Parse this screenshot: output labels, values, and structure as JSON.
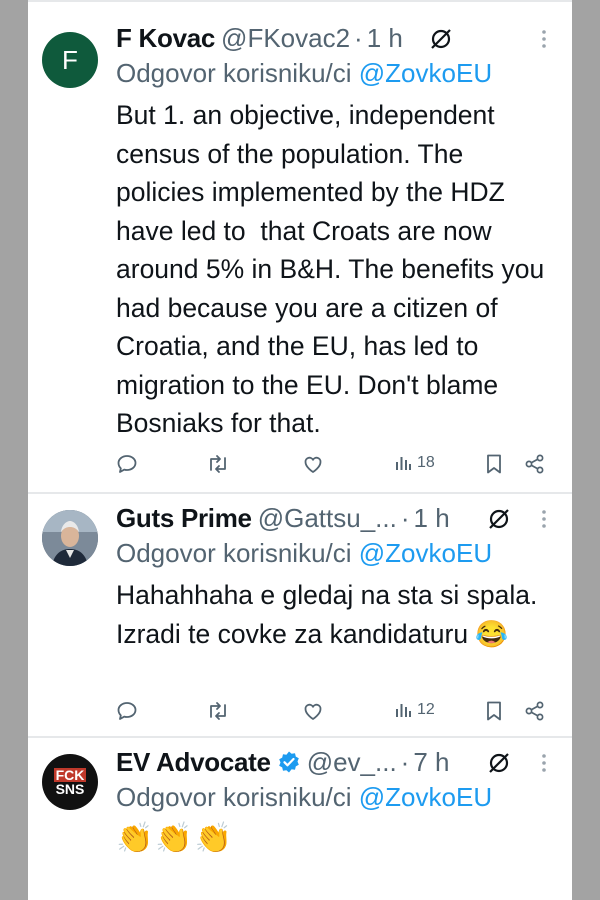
{
  "tweets": [
    {
      "avatar_letter": "F",
      "name": "F Kovac",
      "handle": "@FKovac2",
      "time": "1 h",
      "reply_prefix": "Odgovor korisniku/ci",
      "reply_to": "@ZovkoEU",
      "text": "But 1. an objective, independent census of the population. The policies implemented by the HDZ have led to  that Croats are now around 5% in B&H. The benefits you had because you are a citizen of Croatia, and the EU, has led to migration to the EU. Don't blame Bosniaks for that.",
      "views": "18"
    },
    {
      "name": "Guts Prime",
      "handle": "@Gattsu_...",
      "time": "1 h",
      "reply_prefix": "Odgovor korisniku/ci",
      "reply_to": "@ZovkoEU",
      "text": "Hahahhaha e gledaj na sta si spala. Izradi te covke za kandidaturu 😂",
      "views": "12"
    },
    {
      "avatar_text_1": "FCK",
      "avatar_text_2": "SNS",
      "name": "EV Advocate",
      "handle": "@ev_...",
      "time": "7 h",
      "reply_prefix": "Odgovor korisniku/ci",
      "reply_to": "@ZovkoEU",
      "text": "👏👏👏"
    }
  ],
  "icons": [
    "reply-icon",
    "retweet-icon",
    "like-icon",
    "views-icon",
    "bookmark-icon",
    "share-icon",
    "grok-icon",
    "more-icon",
    "verified-badge-icon"
  ],
  "colors": {
    "accent": "#1d9bf0",
    "avatar_green": "#0f5a3c",
    "secondary_text": "#536471"
  }
}
